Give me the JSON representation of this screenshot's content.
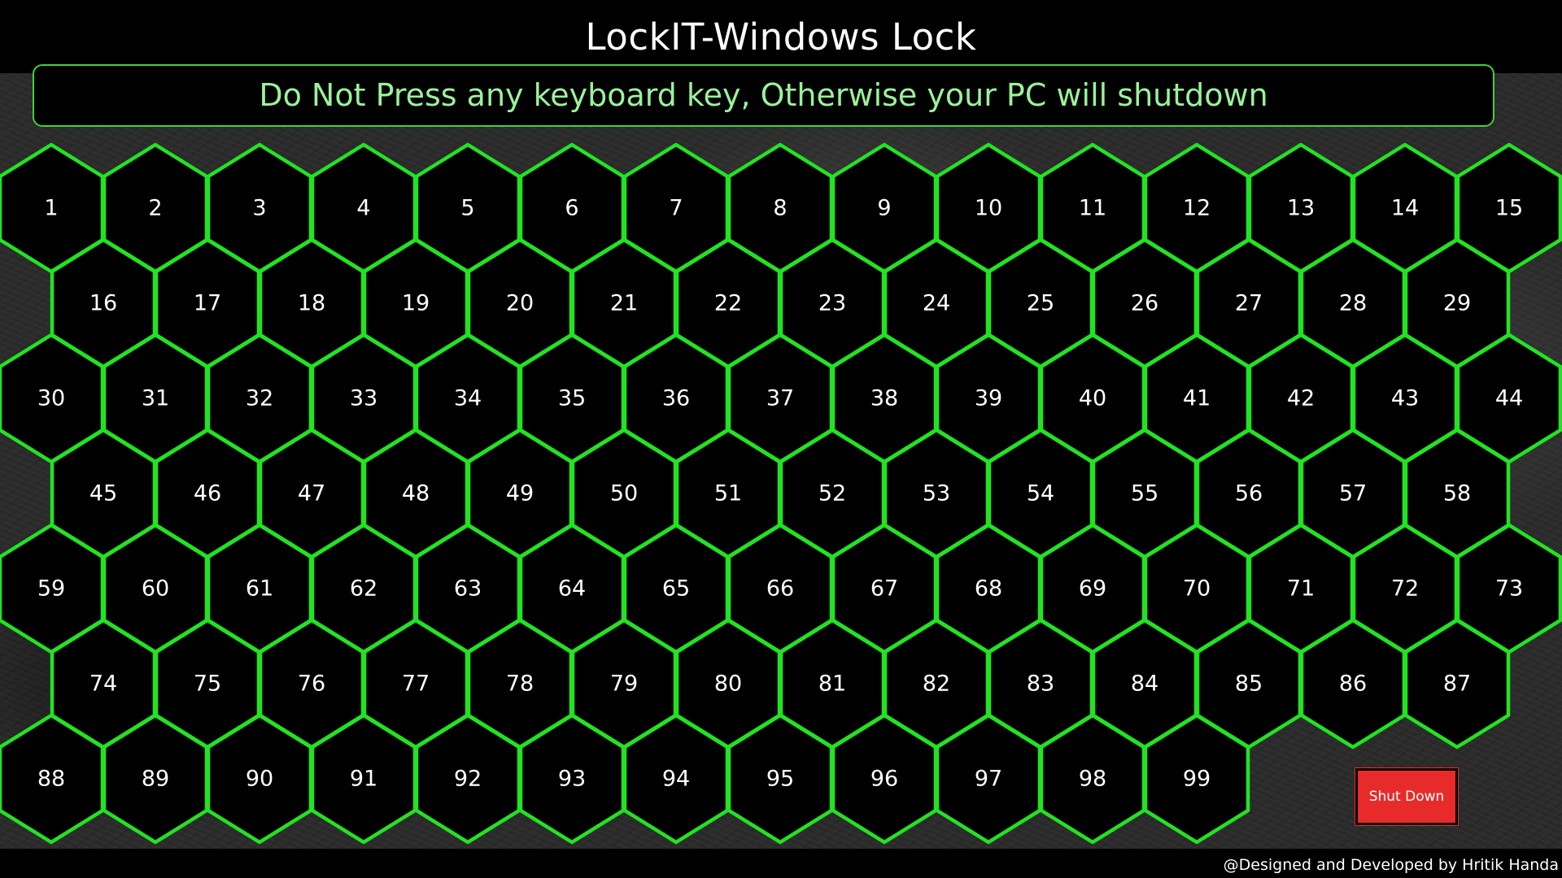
{
  "app": {
    "title": "LockIT-Windows Lock",
    "warning": "Do Not Press any keyboard key, Otherwise your PC will shutdown",
    "credits": "@Designed and Developed by Hritik Handa"
  },
  "keypad": {
    "rows": [
      [
        "1",
        "2",
        "3",
        "4",
        "5",
        "6",
        "7",
        "8",
        "9",
        "10",
        "11",
        "12",
        "13",
        "14",
        "15"
      ],
      [
        "16",
        "17",
        "18",
        "19",
        "20",
        "21",
        "22",
        "23",
        "24",
        "25",
        "26",
        "27",
        "28",
        "29"
      ],
      [
        "30",
        "31",
        "32",
        "33",
        "34",
        "35",
        "36",
        "37",
        "38",
        "39",
        "40",
        "41",
        "42",
        "43",
        "44"
      ],
      [
        "45",
        "46",
        "47",
        "48",
        "49",
        "50",
        "51",
        "52",
        "53",
        "54",
        "55",
        "56",
        "57",
        "58"
      ],
      [
        "59",
        "60",
        "61",
        "62",
        "63",
        "64",
        "65",
        "66",
        "67",
        "68",
        "69",
        "70",
        "71",
        "72",
        "73"
      ],
      [
        "74",
        "75",
        "76",
        "77",
        "78",
        "79",
        "80",
        "81",
        "82",
        "83",
        "84",
        "85",
        "86",
        "87"
      ],
      [
        "88",
        "89",
        "90",
        "91",
        "92",
        "93",
        "94",
        "95",
        "96",
        "97",
        "98",
        "99"
      ]
    ]
  },
  "actions": {
    "shutdown_label": "Shut Down"
  },
  "colors": {
    "hex_border": "#22e322",
    "warning_text": "#9af29a",
    "banner_border": "#3cd43c",
    "shutdown_bg": "#e72b2b",
    "background": "#000000"
  }
}
